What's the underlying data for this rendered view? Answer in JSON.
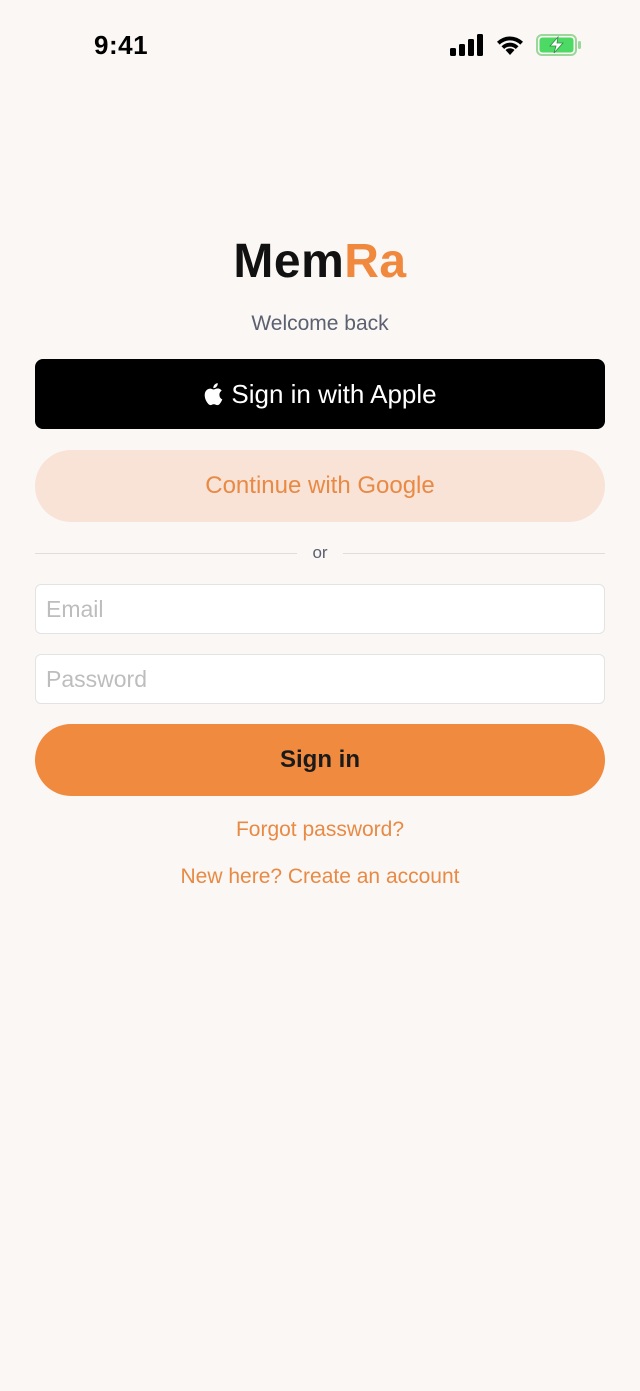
{
  "status_bar": {
    "time": "9:41"
  },
  "brand": {
    "name_part1": "Mem",
    "name_part2": "Ra",
    "accent_color": "#F0883E"
  },
  "subtitle": "Welcome back",
  "apple_button": {
    "icon": "apple-icon",
    "label": "Sign in with Apple"
  },
  "google_button": {
    "label": "Continue with Google"
  },
  "divider": {
    "text": "or"
  },
  "email_field": {
    "value": "",
    "placeholder": "Email"
  },
  "password_field": {
    "value": "",
    "placeholder": "Password"
  },
  "signin_button": {
    "label": "Sign in",
    "color": "#F08A3F"
  },
  "links": {
    "forgot_password": "Forgot password?",
    "create_account": "New here? Create an account"
  },
  "colors": {
    "background": "#FBF7F4",
    "link": "#E88A45",
    "google_bg": "#F8E3D6",
    "battery_green": "#4CD964"
  }
}
